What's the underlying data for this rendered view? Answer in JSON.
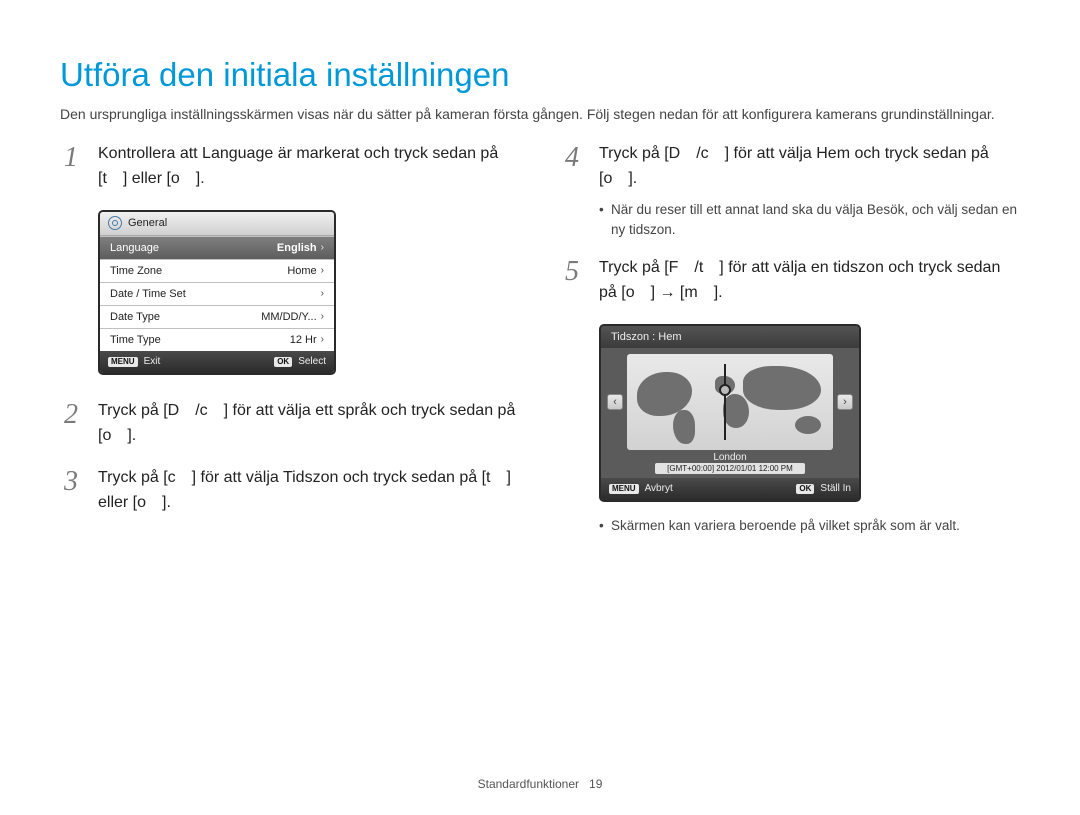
{
  "title": "Utföra den initiala inställningen",
  "intro": "Den ursprungliga inställningsskärmen visas när du sätter på kameran första gången. Följ stegen nedan för att konfigurera kamerans grundinställningar.",
  "left": {
    "s1": "Kontrollera att Language är markerat och tryck sedan på [t ] eller [o ].",
    "s2": "Tryck på [D /c ] för att välja ett språk och tryck sedan på [o ].",
    "s3": "Tryck på [c ] för att välja Tidszon och tryck sedan på [t ] eller [o ]."
  },
  "right": {
    "s4": "Tryck på [D /c ] för att välja Hem och tryck sedan på [o ].",
    "b4": "När du reser till ett annat land ska du välja Besök, och välj sedan en ny tidszon.",
    "s5": "Tryck på [F /t ] för att välja en tidszon och tryck sedan på [o ] → [m ].",
    "b5": "Skärmen kan variera beroende på vilket språk som är valt."
  },
  "numbers": {
    "1": "1",
    "2": "2",
    "3": "3",
    "4": "4",
    "5": "5"
  },
  "cam": {
    "top": "General",
    "rows": [
      {
        "l": "Language",
        "r": "English"
      },
      {
        "l": "Time Zone",
        "r": "Home"
      },
      {
        "l": "Date / Time Set",
        "r": ""
      },
      {
        "l": "Date Type",
        "r": "MM/DD/Y..."
      },
      {
        "l": "Time Type",
        "r": "12 Hr"
      }
    ],
    "bottom": {
      "menu": "MENU",
      "exit": "Exit",
      "ok": "OK",
      "select": "Select"
    }
  },
  "tz": {
    "header": "Tidszon : Hem",
    "city": "London",
    "timestamp": "[GMT+00:00] 2012/01/01 12:00 PM",
    "bottom": {
      "menu": "MENU",
      "cancel": "Avbryt",
      "ok": "OK",
      "set": "Ställ In"
    }
  },
  "footer": {
    "label": "Standardfunktioner",
    "page": "19"
  }
}
